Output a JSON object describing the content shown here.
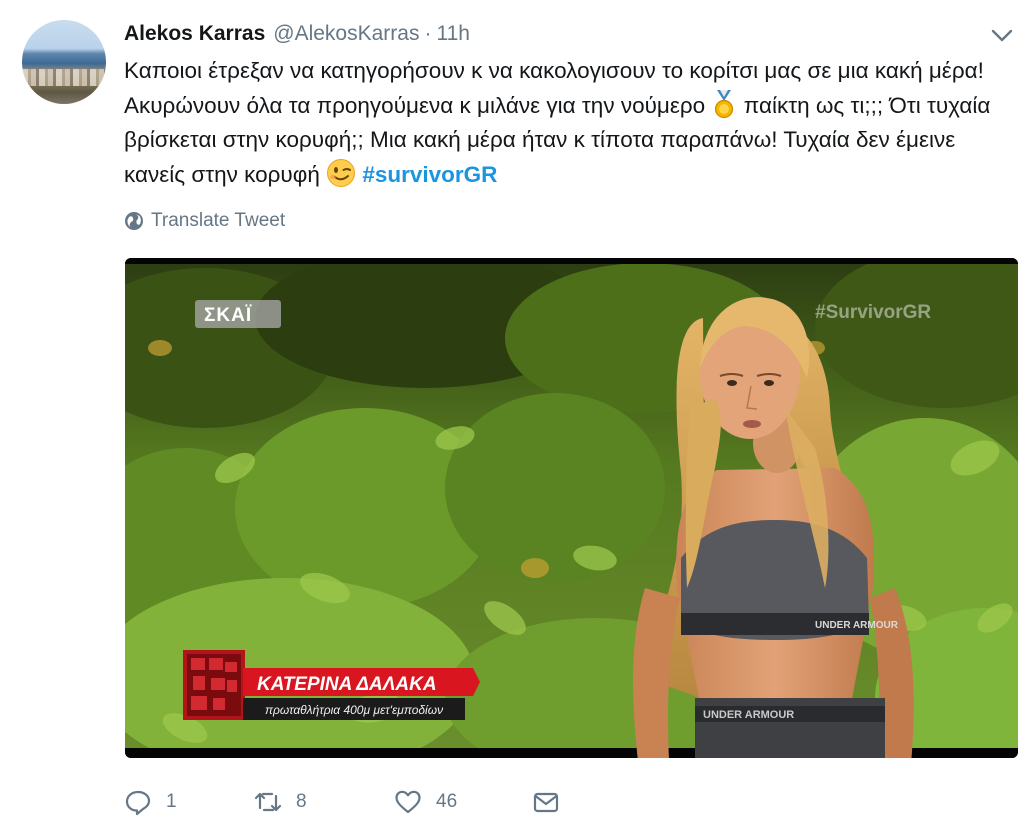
{
  "tweet": {
    "author_name": "Alekos Karras",
    "author_handle": "@AlekosKarras",
    "separator": "·",
    "timestamp": "11h",
    "text_parts": {
      "line1": "Καποιοι έτρεξαν να κατηγορήσουν κ να κακολογισουν το κορίτσι μας σε μια κακή μέρα! Ακυρώνουν όλα τα προηγούμενα κ μιλάνε για την νούμερο",
      "line2": "παίκτη ως τι;;; Ότι τυχαία βρίσκεται στην κορυφή;; Μια κακή μέρα ήταν κ τίποτα παραπάνω! Τυχαία δεν έμεινε κανείς στην κορυφή",
      "hashtag": "#survivorGR"
    },
    "emojis": [
      "medal-emoji",
      "winking-face-emoji"
    ],
    "translate_label": "Translate Tweet",
    "media": {
      "channel_logo": "ΣΚΑΪ",
      "watermark": "#SurvivorGR",
      "caption_name": "ΚΑΤΕΡΙΝΑ ΔΑΛΑΚΑ",
      "caption_sub": "πρωταθλήτρια 400μ μετ'εμποδίων",
      "top_brand": "UNDER ARMOUR",
      "waistband_brand": "UNDER ARMOUR"
    },
    "actions": {
      "reply_count": "1",
      "retweet_count": "8",
      "like_count": "46"
    }
  },
  "icons": {
    "globe": "globe-icon",
    "caret": "chevron-down-icon",
    "reply": "reply-icon",
    "retweet": "retweet-icon",
    "like": "heart-icon",
    "dm": "envelope-icon"
  },
  "colors": {
    "text": "#14171a",
    "secondary": "#657786",
    "hashtag": "#1b95e0"
  }
}
